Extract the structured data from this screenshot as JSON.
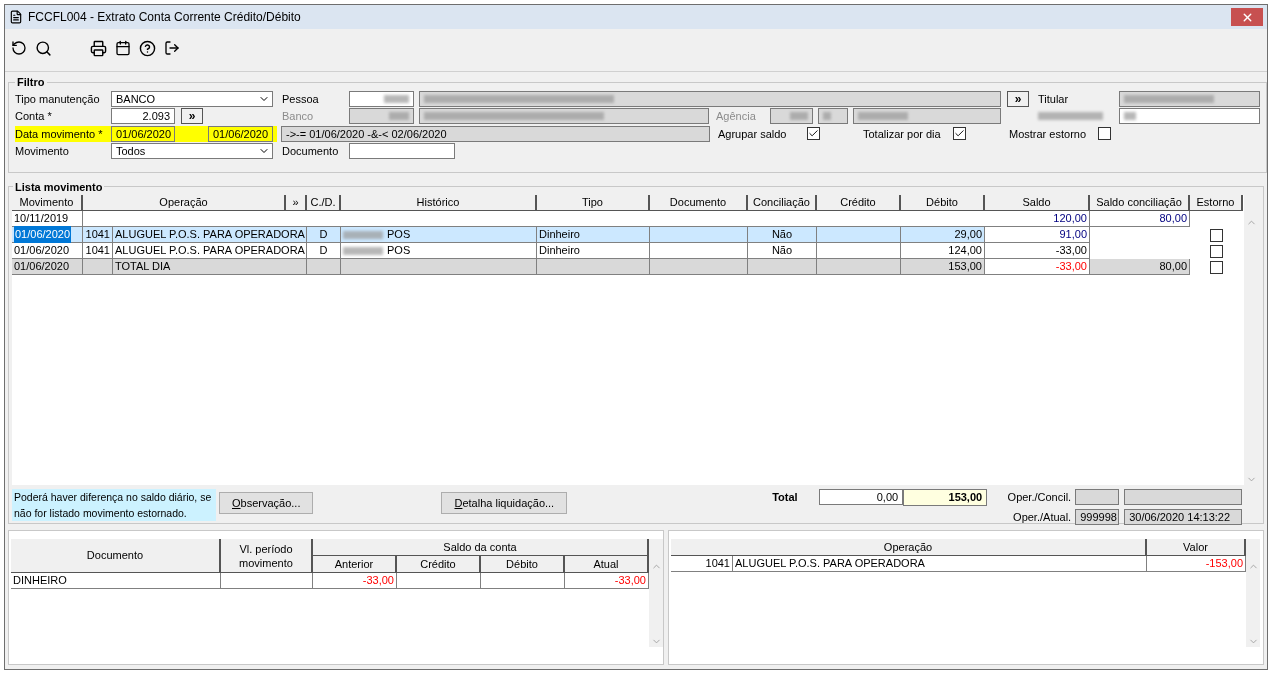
{
  "window": {
    "title": "FCCFL004 - Extrato Conta Corrente Crédito/Débito"
  },
  "filter": {
    "legend": "Filtro",
    "tipo_manutencao": {
      "label": "Tipo manutenção",
      "value": "BANCO"
    },
    "conta": {
      "label": "Conta *",
      "value": "2.093",
      "more": "»"
    },
    "data_movimento": {
      "label": "Data movimento *",
      "from": "01/06/2020",
      "to": "01/06/2020",
      "expression": "->-= 01/06/2020 -&-< 02/06/2020"
    },
    "movimento": {
      "label": "Movimento",
      "value": "Todos"
    },
    "pessoa": {
      "label": "Pessoa",
      "more": "»",
      "redacted": true
    },
    "banco": {
      "label": "Banco",
      "disabled": true,
      "redacted": true
    },
    "agencia": {
      "label": "Agência",
      "disabled": true,
      "redacted": true
    },
    "documento": {
      "label": "Documento"
    },
    "titular": {
      "label": "Titular",
      "redacted": true
    },
    "numero_conta": {
      "redacted": true
    },
    "options": [
      {
        "label": "Agrupar saldo",
        "checked": true
      },
      {
        "label": "Totalizar por dia",
        "checked": true
      },
      {
        "label": "Mostrar estorno",
        "checked": false
      }
    ]
  },
  "lista": {
    "legend": "Lista movimento",
    "columns": [
      "Movimento",
      "Operação",
      "»",
      "C./D.",
      "Histórico",
      "Tipo",
      "Documento",
      "Conciliação",
      "Crédito",
      "Débito",
      "Saldo",
      "Saldo conciliação",
      "Estorno"
    ],
    "rows": [
      {
        "kind": "opening",
        "movimento": "10/11/2019",
        "saldo": {
          "text": "120,00",
          "kind": "blue"
        },
        "saldo_conciliacao": "80,00"
      },
      {
        "kind": "entry",
        "selected": true,
        "movimento": "01/06/2020",
        "codigo": "1041",
        "operacao": "ALUGUEL P.O.S. PARA OPERADORA",
        "cd": "D",
        "historico": "POS",
        "historico_redacted": true,
        "tipo": "Dinheiro",
        "conciliacao": "Não",
        "debito": "29,00",
        "saldo": {
          "text": "91,00",
          "kind": "blue"
        },
        "estorno": false
      },
      {
        "kind": "entry",
        "selected": false,
        "movimento": "01/06/2020",
        "codigo": "1041",
        "operacao": "ALUGUEL P.O.S. PARA OPERADORA",
        "cd": "D",
        "historico": "POS",
        "historico_redacted": true,
        "tipo": "Dinheiro",
        "conciliacao": "Não",
        "debito": "124,00",
        "saldo": {
          "text": "-33,00",
          "kind": "plain"
        },
        "estorno": false
      },
      {
        "kind": "total",
        "movimento": "01/06/2020",
        "operacao": "TOTAL DIA",
        "debito": "153,00",
        "saldo": {
          "text": "-33,00",
          "kind": "alert"
        },
        "saldo_conciliacao": "80,00",
        "estorno": false
      }
    ],
    "note": "Poderá haver diferença no saldo diário, se não for listado movimento estornado.",
    "buttons": [
      {
        "mnemonic": "O",
        "rest": "bservação..."
      },
      {
        "mnemonic": "D",
        "rest": "etalha liquidação..."
      }
    ],
    "total": {
      "label": "Total",
      "credito": "0,00",
      "debito": "153,00"
    },
    "oper_concil": {
      "label": "Oper./Concil."
    },
    "oper_atual": {
      "label": "Oper./Atual.",
      "user": "999998",
      "time": "30/06/2020 14:13:22"
    }
  },
  "documentos": {
    "columns": {
      "documento": "Documento",
      "periodo": "Vl. período movimento",
      "group": "Saldo da conta",
      "sub": [
        "Anterior",
        "Crédito",
        "Débito",
        "Atual"
      ]
    },
    "rows": [
      {
        "documento": "DINHEIRO",
        "anterior": "-33,00",
        "credito": "",
        "debito": "",
        "atual": "-33,00"
      }
    ]
  },
  "operacoes": {
    "columns": [
      "Operação",
      "Valor"
    ],
    "rows": [
      {
        "codigo": "1041",
        "operacao": "ALUGUEL P.O.S. PARA OPERADORA",
        "valor": "-153,00"
      }
    ]
  }
}
